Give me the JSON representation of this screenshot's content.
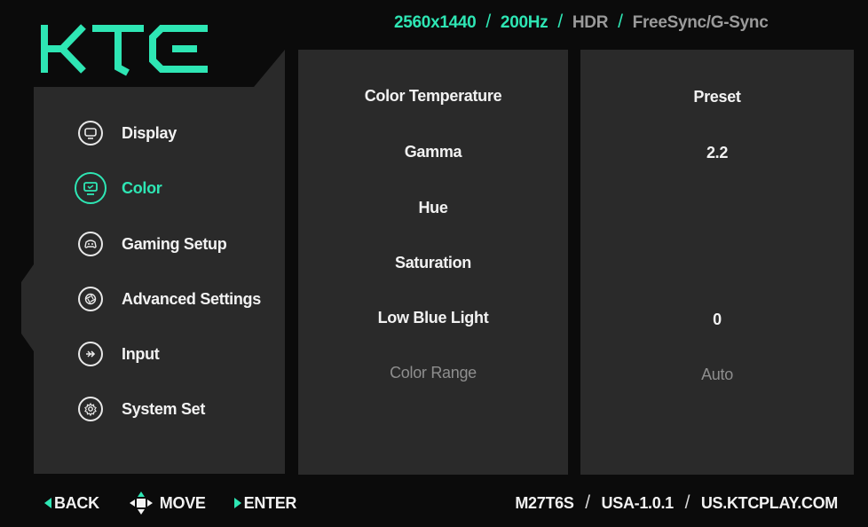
{
  "brand": {
    "logo_text": "KTC",
    "accent_color": "#2ee6b4"
  },
  "top_info": {
    "resolution": "2560x1440",
    "refresh_rate": "200Hz",
    "hdr": "HDR",
    "sync": "FreeSync/G-Sync",
    "separator": "/"
  },
  "menu": {
    "items": [
      {
        "label": "Display",
        "icon": "monitor-icon",
        "active": false
      },
      {
        "label": "Color",
        "icon": "color-display-icon",
        "active": true
      },
      {
        "label": "Gaming Setup",
        "icon": "gamepad-icon",
        "active": false
      },
      {
        "label": "Advanced Settings",
        "icon": "aperture-icon",
        "active": false
      },
      {
        "label": "Input",
        "icon": "input-arrow-icon",
        "active": false
      },
      {
        "label": "System Set",
        "icon": "gear-icon",
        "active": false
      }
    ]
  },
  "settings": {
    "rows": [
      {
        "label": "Color Temperature",
        "value": "Preset",
        "enabled": true
      },
      {
        "label": "Gamma",
        "value": "2.2",
        "enabled": true
      },
      {
        "label": "Hue",
        "value": "",
        "enabled": true
      },
      {
        "label": "Saturation",
        "value": "",
        "enabled": true
      },
      {
        "label": "Low Blue Light",
        "value": "0",
        "enabled": true
      },
      {
        "label": "Color Range",
        "value": "Auto",
        "enabled": false
      }
    ]
  },
  "footer": {
    "back": "BACK",
    "move": "MOVE",
    "enter": "ENTER",
    "model": "M27T6S",
    "firmware": "USA-1.0.1",
    "website": "US.KTCPLAY.COM",
    "separator": "/"
  }
}
